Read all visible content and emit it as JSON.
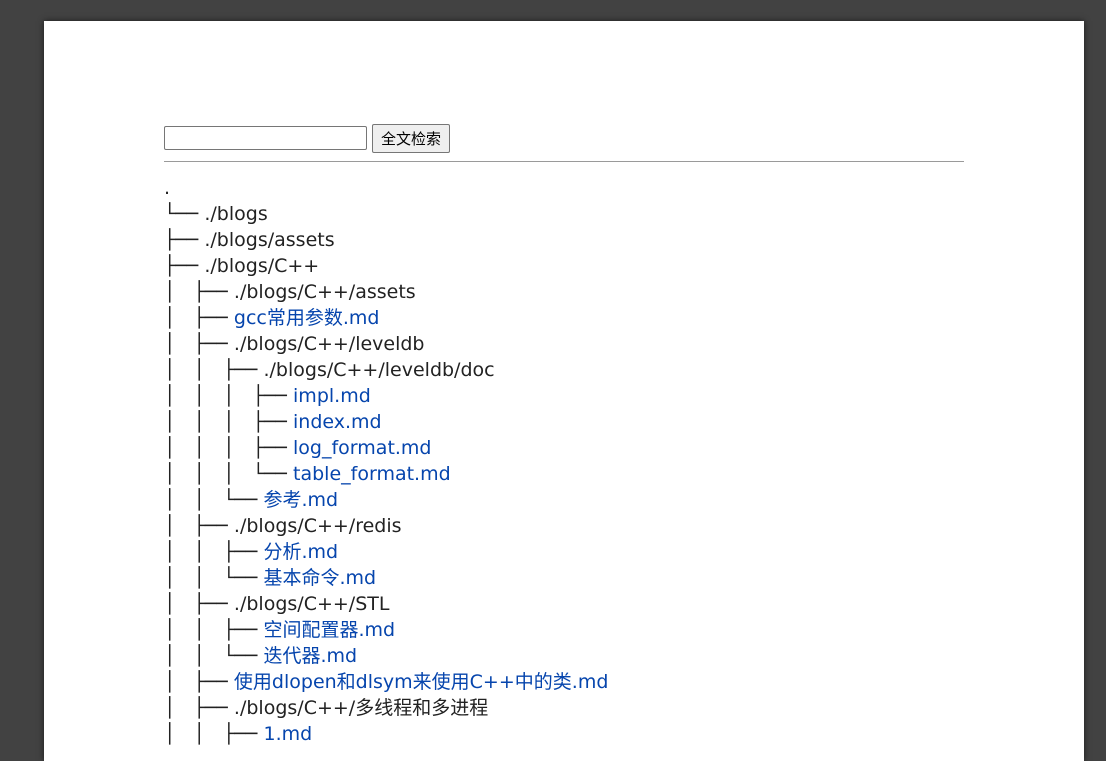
{
  "search": {
    "placeholder": "",
    "value": "",
    "button_label": "全文检索"
  },
  "tree": {
    "root": ".",
    "lines": [
      {
        "prefix": "└── ",
        "text": "./blogs",
        "kind": "dir"
      },
      {
        "prefix": "├── ",
        "text": "./blogs/assets",
        "kind": "dir"
      },
      {
        "prefix": "├── ",
        "text": "./blogs/C++",
        "kind": "dir"
      },
      {
        "prefix": "│   ├── ",
        "text": "./blogs/C++/assets",
        "kind": "dir"
      },
      {
        "prefix": "│   ├── ",
        "text": "gcc常用参数.md",
        "kind": "file"
      },
      {
        "prefix": "│   ├── ",
        "text": "./blogs/C++/leveldb",
        "kind": "dir"
      },
      {
        "prefix": "│   │   ├── ",
        "text": "./blogs/C++/leveldb/doc",
        "kind": "dir"
      },
      {
        "prefix": "│   │   │   ├── ",
        "text": "impl.md",
        "kind": "file"
      },
      {
        "prefix": "│   │   │   ├── ",
        "text": "index.md",
        "kind": "file"
      },
      {
        "prefix": "│   │   │   ├── ",
        "text": "log_format.md",
        "kind": "file"
      },
      {
        "prefix": "│   │   │   └── ",
        "text": "table_format.md",
        "kind": "file"
      },
      {
        "prefix": "│   │   └── ",
        "text": "参考.md",
        "kind": "file"
      },
      {
        "prefix": "│   ├── ",
        "text": "./blogs/C++/redis",
        "kind": "dir"
      },
      {
        "prefix": "│   │   ├── ",
        "text": "分析.md",
        "kind": "file"
      },
      {
        "prefix": "│   │   └── ",
        "text": "基本命令.md",
        "kind": "file"
      },
      {
        "prefix": "│   ├── ",
        "text": "./blogs/C++/STL",
        "kind": "dir"
      },
      {
        "prefix": "│   │   ├── ",
        "text": "空间配置器.md",
        "kind": "file"
      },
      {
        "prefix": "│   │   └── ",
        "text": "迭代器.md",
        "kind": "file"
      },
      {
        "prefix": "│   ├── ",
        "text": "使用dlopen和dlsym来使用C++中的类.md",
        "kind": "file"
      },
      {
        "prefix": "│   ├── ",
        "text": "./blogs/C++/多线程和多进程",
        "kind": "dir"
      },
      {
        "prefix": "│   │   ├── ",
        "text": "1.md",
        "kind": "file"
      }
    ]
  },
  "colors": {
    "backdrop": "#424242",
    "page": "#ffffff",
    "link": "#0645ad",
    "text": "#222222"
  }
}
